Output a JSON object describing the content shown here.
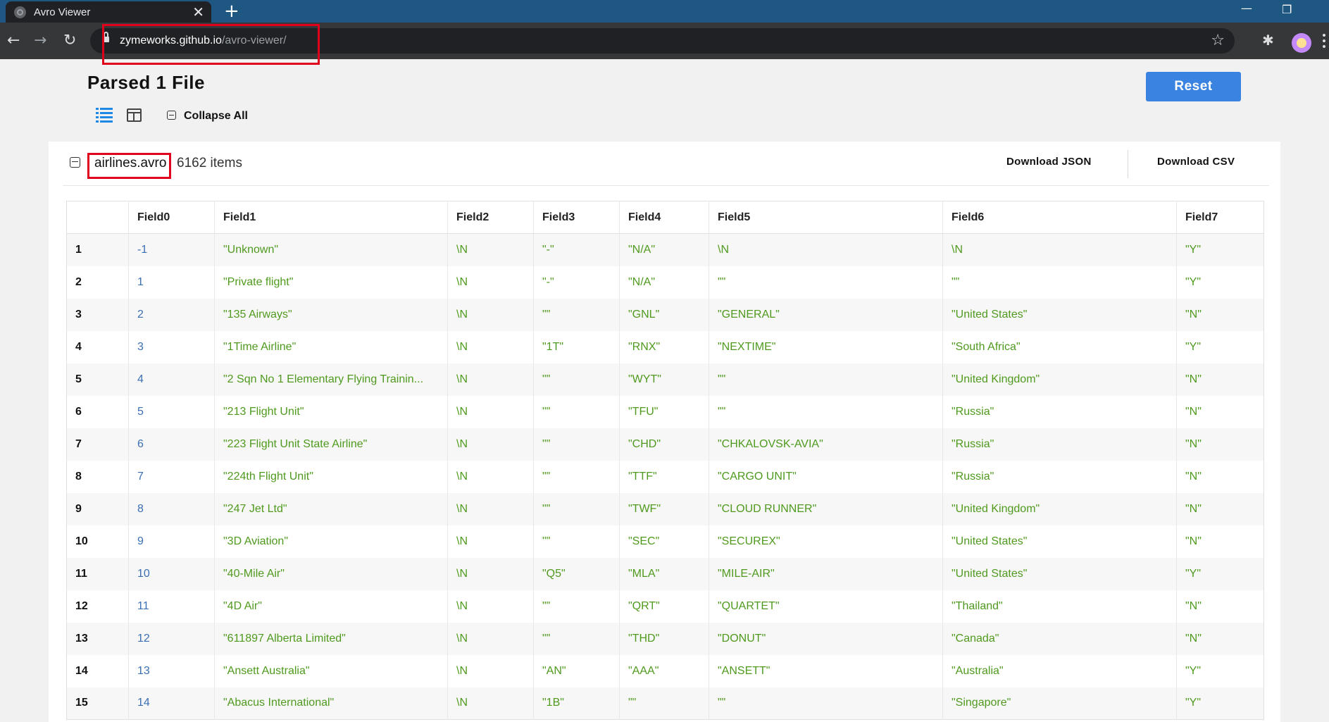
{
  "browser": {
    "tab_title": "Avro Viewer",
    "tab_close": "✕",
    "new_tab": "+",
    "url_host": "zymeworks.github.io",
    "url_path": "/avro-viewer/",
    "icons": [
      "back-icon",
      "forward-icon",
      "reload-icon",
      "lock-icon",
      "star-icon",
      "extensions-icon",
      "profile-avatar",
      "menu-icon",
      "minimize-icon",
      "restore-icon"
    ]
  },
  "page": {
    "title": "Parsed 1 File",
    "reset_label": "Reset",
    "collapse_all_label": "Collapse All"
  },
  "file": {
    "name": "airlines.avro",
    "count": "6162 items",
    "download_json_label": "Download JSON",
    "download_csv_label": "Download CSV"
  },
  "table": {
    "columns": [
      "",
      "Field0",
      "Field1",
      "Field2",
      "Field3",
      "Field4",
      "Field5",
      "Field6",
      "Field7"
    ],
    "rows": [
      [
        "1",
        "-1",
        "\"Unknown\"",
        "\\N",
        "\"-\"",
        "\"N/A\"",
        "\\N",
        "\\N",
        "\"Y\""
      ],
      [
        "2",
        "1",
        "\"Private flight\"",
        "\\N",
        "\"-\"",
        "\"N/A\"",
        "\"\"",
        "\"\"",
        "\"Y\""
      ],
      [
        "3",
        "2",
        "\"135 Airways\"",
        "\\N",
        "\"\"",
        "\"GNL\"",
        "\"GENERAL\"",
        "\"United States\"",
        "\"N\""
      ],
      [
        "4",
        "3",
        "\"1Time Airline\"",
        "\\N",
        "\"1T\"",
        "\"RNX\"",
        "\"NEXTIME\"",
        "\"South Africa\"",
        "\"Y\""
      ],
      [
        "5",
        "4",
        "\"2 Sqn No 1 Elementary Flying Trainin...",
        "\\N",
        "\"\"",
        "\"WYT\"",
        "\"\"",
        "\"United Kingdom\"",
        "\"N\""
      ],
      [
        "6",
        "5",
        "\"213 Flight Unit\"",
        "\\N",
        "\"\"",
        "\"TFU\"",
        "\"\"",
        "\"Russia\"",
        "\"N\""
      ],
      [
        "7",
        "6",
        "\"223 Flight Unit State Airline\"",
        "\\N",
        "\"\"",
        "\"CHD\"",
        "\"CHKALOVSK-AVIA\"",
        "\"Russia\"",
        "\"N\""
      ],
      [
        "8",
        "7",
        "\"224th Flight Unit\"",
        "\\N",
        "\"\"",
        "\"TTF\"",
        "\"CARGO UNIT\"",
        "\"Russia\"",
        "\"N\""
      ],
      [
        "9",
        "8",
        "\"247 Jet Ltd\"",
        "\\N",
        "\"\"",
        "\"TWF\"",
        "\"CLOUD RUNNER\"",
        "\"United Kingdom\"",
        "\"N\""
      ],
      [
        "10",
        "9",
        "\"3D Aviation\"",
        "\\N",
        "\"\"",
        "\"SEC\"",
        "\"SECUREX\"",
        "\"United States\"",
        "\"N\""
      ],
      [
        "11",
        "10",
        "\"40-Mile Air\"",
        "\\N",
        "\"Q5\"",
        "\"MLA\"",
        "\"MILE-AIR\"",
        "\"United States\"",
        "\"Y\""
      ],
      [
        "12",
        "11",
        "\"4D Air\"",
        "\\N",
        "\"\"",
        "\"QRT\"",
        "\"QUARTET\"",
        "\"Thailand\"",
        "\"N\""
      ],
      [
        "13",
        "12",
        "\"611897 Alberta Limited\"",
        "\\N",
        "\"\"",
        "\"THD\"",
        "\"DONUT\"",
        "\"Canada\"",
        "\"N\""
      ],
      [
        "14",
        "13",
        "\"Ansett Australia\"",
        "\\N",
        "\"AN\"",
        "\"AAA\"",
        "\"ANSETT\"",
        "\"Australia\"",
        "\"Y\""
      ],
      [
        "15",
        "14",
        "\"Abacus International\"",
        "\\N",
        "\"1B\"",
        "\"\"",
        "\"\"",
        "\"Singapore\"",
        "\"Y\""
      ]
    ]
  },
  "colors": {
    "accent": "#3a83e0",
    "number_value": "#3b6fb5",
    "string_value": "#4f9a1e",
    "highlight_box": "#e0001b"
  }
}
